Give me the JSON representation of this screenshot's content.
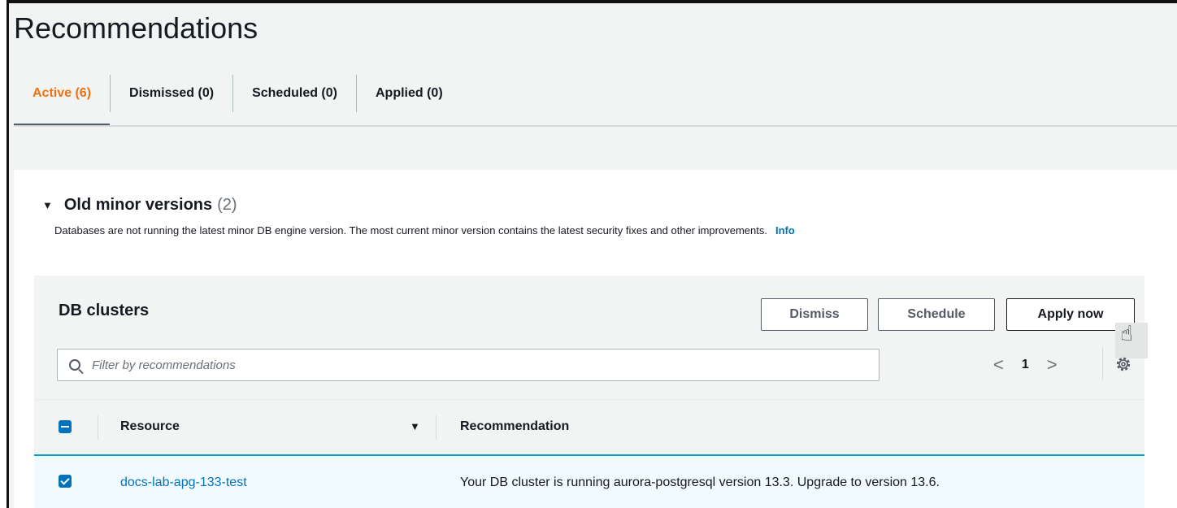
{
  "page": {
    "title": "Recommendations"
  },
  "tabs": [
    {
      "label": "Active (6)"
    },
    {
      "label": "Dismissed (0)"
    },
    {
      "label": "Scheduled (0)"
    },
    {
      "label": "Applied (0)"
    }
  ],
  "group": {
    "title": "Old minor versions",
    "count": "(2)",
    "description": "Databases are not running the latest minor DB engine version. The most current minor version contains the latest security fixes and other improvements.",
    "info_link": "Info"
  },
  "container": {
    "title": "DB clusters",
    "buttons": {
      "dismiss": "Dismiss",
      "schedule": "Schedule",
      "apply": "Apply now"
    },
    "search": {
      "placeholder": "Filter by recommendations",
      "value": ""
    },
    "pagination": {
      "current_page": "1"
    }
  },
  "table": {
    "columns": {
      "resource": "Resource",
      "recommendation": "Recommendation"
    },
    "rows": [
      {
        "resource": "docs-lab-apg-133-test",
        "recommendation": "Your DB cluster is running aurora-postgresql version 13.3. Upgrade to version 13.6."
      }
    ]
  },
  "colors": {
    "active_tab": "#ec7211",
    "link": "#0073bb",
    "selected_row": "#f1faff"
  },
  "icons": [
    "search-icon",
    "gear-icon",
    "chevron-left-icon",
    "chevron-right-icon",
    "caret-down-icon",
    "hand-cursor-icon"
  ]
}
